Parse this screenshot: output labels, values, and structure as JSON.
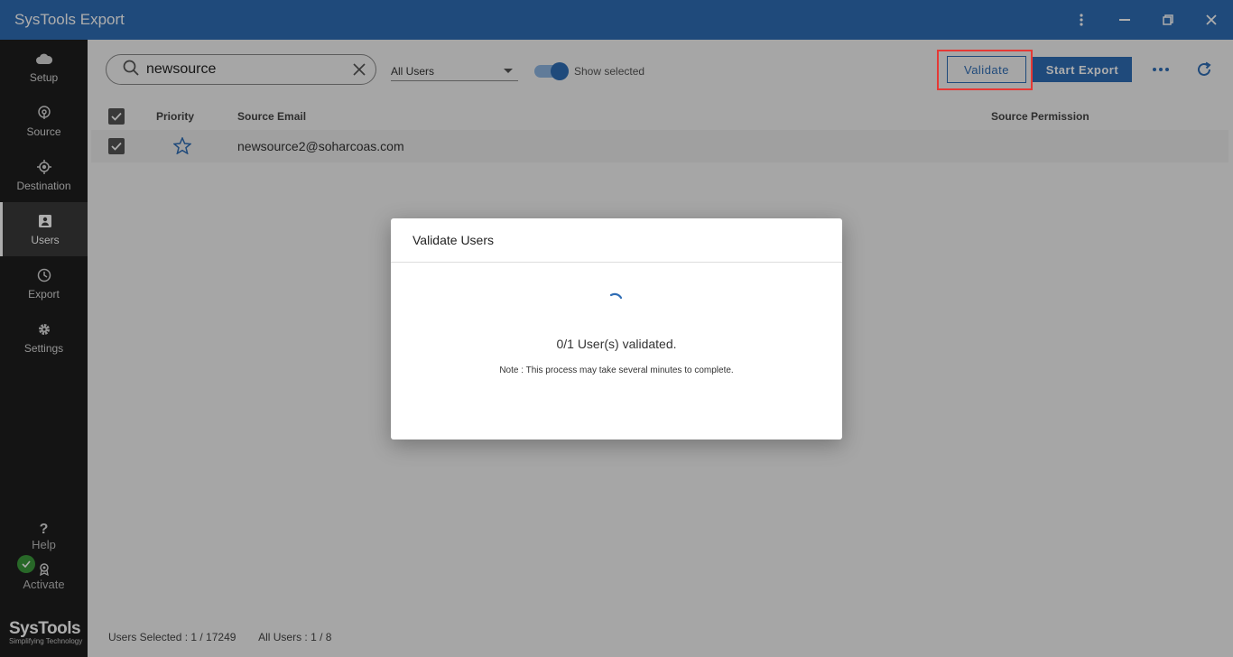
{
  "app": {
    "title": "SysTools Export"
  },
  "sidebar": {
    "items": [
      {
        "label": "Setup",
        "icon": "cloud-icon"
      },
      {
        "label": "Source",
        "icon": "source-icon"
      },
      {
        "label": "Destination",
        "icon": "destination-icon"
      },
      {
        "label": "Users",
        "icon": "users-icon"
      },
      {
        "label": "Export",
        "icon": "clock-icon"
      },
      {
        "label": "Settings",
        "icon": "gear-icon"
      }
    ],
    "active": "Users",
    "help_label": "Help",
    "activate_label": "Activate",
    "brand_name": "SysTools",
    "brand_tagline": "Simplifying Technology"
  },
  "toolbar": {
    "search_value": "newsource",
    "filter_value": "All Users",
    "toggle_label": "Show selected",
    "toggle_on": true,
    "validate_label": "Validate",
    "export_label": "Start Export"
  },
  "table": {
    "columns": [
      "Priority",
      "Source Email",
      "Source Permission"
    ],
    "rows": [
      {
        "checked": true,
        "priority": "star",
        "email": "newsource2@soharcoas.com",
        "permission": ""
      }
    ]
  },
  "footer": {
    "users_selected": "Users Selected : 1 / 17249",
    "all_users": "All Users : 1 / 8"
  },
  "modal": {
    "title": "Validate Users",
    "status": "0/1 User(s) validated.",
    "note": "Note : This process may take several minutes to complete."
  },
  "colors": {
    "accent": "#2f6db5",
    "highlight": "#e53935",
    "sidebar": "#1e1e1e"
  }
}
